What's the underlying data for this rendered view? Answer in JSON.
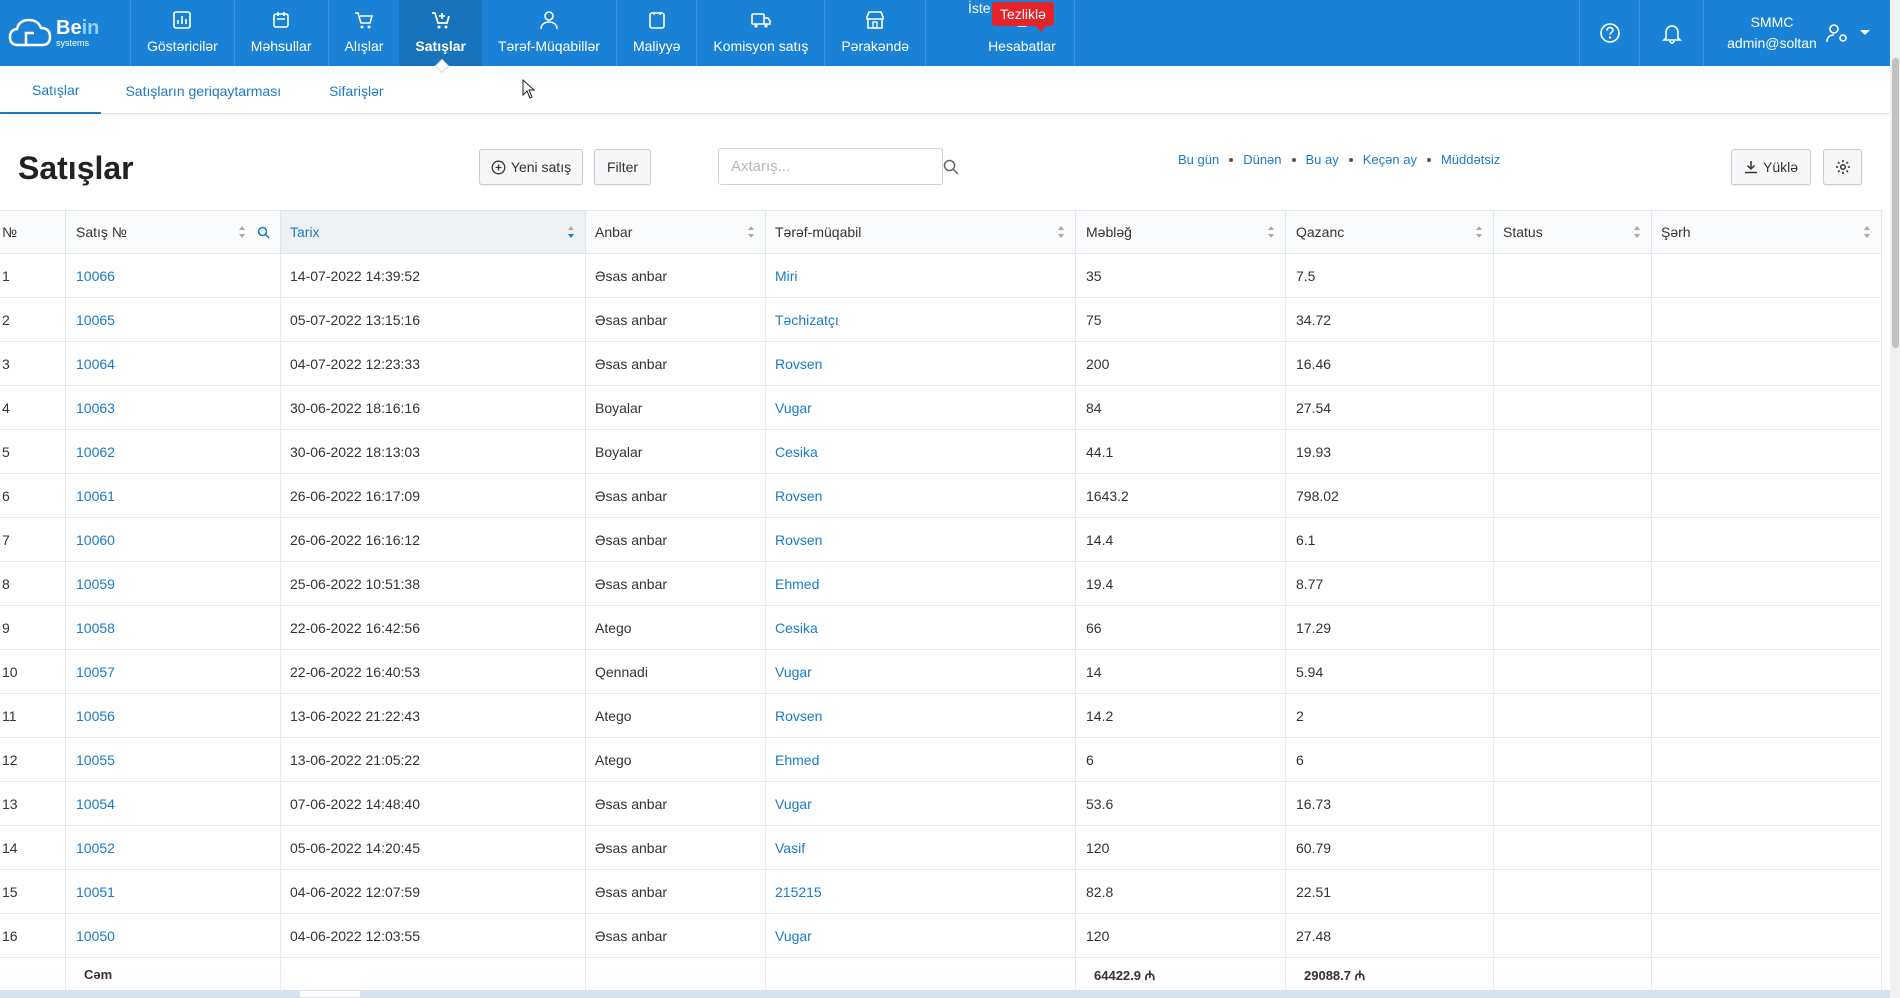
{
  "brand": {
    "logo_main": "Be",
    "logo_accent": "in",
    "logo_sub": "systems"
  },
  "nav": {
    "items": [
      {
        "label": "Göstəricilər",
        "icon": "chart-icon"
      },
      {
        "label": "Məhsullar",
        "icon": "box-icon"
      },
      {
        "label": "Alışlar",
        "icon": "cart-icon"
      },
      {
        "label": "Satışlar",
        "icon": "cart-plus-icon"
      },
      {
        "label": "Tərəf-Müqabillər",
        "icon": "people-icon"
      },
      {
        "label": "Maliyyə",
        "icon": "wallet-icon"
      },
      {
        "label": "Komisyon satış",
        "icon": "truck-icon"
      },
      {
        "label": "Pərakəndə",
        "icon": "store-icon"
      },
      {
        "label": "Hesabatlar",
        "icon": "hand-chart-icon"
      }
    ],
    "cut_label": "İste",
    "badge": "Tezliklə",
    "user_company": "SMMC",
    "user_email": "admin@soltan"
  },
  "subtabs": [
    "Satışlar",
    "Satışların geriqaytarması",
    "Sifarişlər"
  ],
  "toolbar": {
    "title": "Satışlar",
    "new_label": "Yeni satış",
    "filter_label": "Filter",
    "search_placeholder": "Axtarış...",
    "quick_filters": [
      "Bu gün",
      "Dünən",
      "Bu ay",
      "Keçən ay",
      "Müddətsiz"
    ],
    "download_label": "Yüklə"
  },
  "table": {
    "columns": [
      "№",
      "Satış №",
      "Tarix",
      "Anbar",
      "Tərəf-müqabil",
      "Məbləğ",
      "Qazanc",
      "Status",
      "Şərh"
    ],
    "rows": [
      [
        "1",
        "10066",
        "14-07-2022 14:39:52",
        "Əsas anbar",
        "Miri",
        "35",
        "7.5",
        "",
        ""
      ],
      [
        "2",
        "10065",
        "05-07-2022 13:15:16",
        "Əsas anbar",
        "Təchizatçı",
        "75",
        "34.72",
        "",
        ""
      ],
      [
        "3",
        "10064",
        "04-07-2022 12:23:33",
        "Əsas anbar",
        "Rovsen",
        "200",
        "16.46",
        "",
        ""
      ],
      [
        "4",
        "10063",
        "30-06-2022 18:16:16",
        "Boyalar",
        "Vugar",
        "84",
        "27.54",
        "",
        ""
      ],
      [
        "5",
        "10062",
        "30-06-2022 18:13:03",
        "Boyalar",
        "Cesika",
        "44.1",
        "19.93",
        "",
        ""
      ],
      [
        "6",
        "10061",
        "26-06-2022 16:17:09",
        "Əsas anbar",
        "Rovsen",
        "1643.2",
        "798.02",
        "",
        ""
      ],
      [
        "7",
        "10060",
        "26-06-2022 16:16:12",
        "Əsas anbar",
        "Rovsen",
        "14.4",
        "6.1",
        "",
        ""
      ],
      [
        "8",
        "10059",
        "25-06-2022 10:51:38",
        "Əsas anbar",
        "Ehmed",
        "19.4",
        "8.77",
        "",
        ""
      ],
      [
        "9",
        "10058",
        "22-06-2022 16:42:56",
        "Atego",
        "Cesika",
        "66",
        "17.29",
        "",
        ""
      ],
      [
        "10",
        "10057",
        "22-06-2022 16:40:53",
        "Qennadi",
        "Vugar",
        "14",
        "5.94",
        "",
        ""
      ],
      [
        "11",
        "10056",
        "13-06-2022 21:22:43",
        "Atego",
        "Rovsen",
        "14.2",
        "2",
        "",
        ""
      ],
      [
        "12",
        "10055",
        "13-06-2022 21:05:22",
        "Atego",
        "Ehmed",
        "6",
        "6",
        "",
        ""
      ],
      [
        "13",
        "10054",
        "07-06-2022 14:48:40",
        "Əsas anbar",
        "Vugar",
        "53.6",
        "16.73",
        "",
        ""
      ],
      [
        "14",
        "10052",
        "05-06-2022 14:20:45",
        "Əsas anbar",
        "Vasif",
        "120",
        "60.79",
        "",
        ""
      ],
      [
        "15",
        "10051",
        "04-06-2022 12:07:59",
        "Əsas anbar",
        "215215",
        "82.8",
        "22.51",
        "",
        ""
      ],
      [
        "16",
        "10050",
        "04-06-2022 12:03:55",
        "Əsas anbar",
        "Vugar",
        "120",
        "27.48",
        "",
        ""
      ]
    ],
    "footer": {
      "label": "Cəm",
      "amount_total": "64422.9 ₼",
      "profit_total": "29088.7 ₼"
    }
  },
  "colors": {
    "primary": "#1a82d6",
    "link": "#1a7bc7",
    "badge": "#e3242b"
  }
}
